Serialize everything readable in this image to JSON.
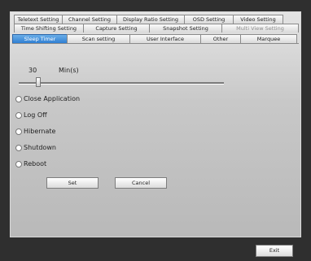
{
  "tabs": {
    "row1": [
      "Teletext Setting",
      "Channel Setting",
      "Display Ratio Setting",
      "OSD Setting",
      "Video Setting"
    ],
    "row2": [
      "Time Shifting Setting",
      "Capture Setting",
      "Snapshot Setting",
      "Multi View Setting"
    ],
    "row3": [
      "Sleep Timer",
      "Scan setting",
      "User Interface",
      "Other",
      "Marquee"
    ]
  },
  "sleep_timer": {
    "value": "30",
    "unit": "Min(s)",
    "options": [
      "Close Application",
      "Log Off",
      "Hibernate",
      "Shutdown",
      "Reboot"
    ]
  },
  "buttons": {
    "set": "Set",
    "cancel": "Cancel",
    "exit": "Exit"
  }
}
